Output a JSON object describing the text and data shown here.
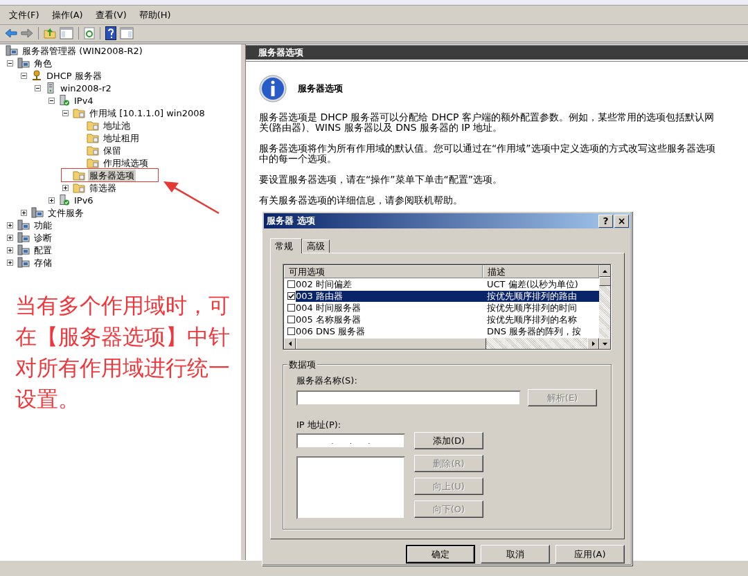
{
  "menu": [
    "文件(F)",
    "操作(A)",
    "查看(V)",
    "帮助(H)"
  ],
  "tree": {
    "label": "服务器管理器 (WIN2008-R2)",
    "kind": "computer",
    "selected": false,
    "children": [
      {
        "label": "角色",
        "kind": "computer",
        "expanded": true,
        "selected": false,
        "children": [
          {
            "label": "DHCP 服务器",
            "kind": "network",
            "expanded": true,
            "selected": false,
            "children": [
              {
                "label": "win2008-r2",
                "kind": "tower",
                "expanded": true,
                "selected": false,
                "children": [
                  {
                    "label": "IPv4",
                    "kind": "tower-check",
                    "expanded": true,
                    "selected": false,
                    "children": [
                      {
                        "label": "作用域 [10.1.1.0] win2008",
                        "kind": "folder",
                        "expanded": true,
                        "selected": false,
                        "children": [
                          {
                            "label": "地址池",
                            "kind": "folder",
                            "selected": false
                          },
                          {
                            "label": "地址租用",
                            "kind": "folder",
                            "selected": false
                          },
                          {
                            "label": "保留",
                            "kind": "folder",
                            "selected": false
                          },
                          {
                            "label": "作用域选项",
                            "kind": "folder",
                            "selected": false
                          }
                        ]
                      },
                      {
                        "label": "服务器选项",
                        "kind": "folder",
                        "selected": true
                      },
                      {
                        "label": "筛选器",
                        "kind": "folder",
                        "expanded": false,
                        "selected": false
                      }
                    ]
                  },
                  {
                    "label": "IPv6",
                    "kind": "tower-check",
                    "expanded": false,
                    "selected": false
                  }
                ]
              }
            ]
          },
          {
            "label": "文件服务",
            "kind": "computer",
            "expanded": false,
            "selected": false
          }
        ]
      },
      {
        "label": "功能",
        "kind": "computer",
        "expanded": false,
        "selected": false
      },
      {
        "label": "诊断",
        "kind": "computer",
        "expanded": false,
        "selected": false
      },
      {
        "label": "配置",
        "kind": "computer",
        "expanded": false,
        "selected": false
      },
      {
        "label": "存储",
        "kind": "computer",
        "expanded": false,
        "selected": false
      }
    ]
  },
  "annotation": "当有多个作用域时，可在【服务器选项】中针对所有作用域进行统一设置。",
  "details": {
    "header": "服务器选项",
    "title": "服务器选项",
    "paragraphs": [
      "服务器选项是 DHCP 服务器可以分配给 DHCP 客户端的额外配置参数。例如，某些常用的选项包括默认网关(路由器)、WINS 服务器以及 DNS 服务器的 IP 地址。",
      "服务器选项将作为所有作用域的默认值。您可以通过在“作用域”选项中定义选项的方式改写这些服务器选项中的每一个选项。",
      "要设置服务器选项，请在“操作”菜单下单击“配置”选项。",
      "有关服务器选项的详细信息，请参阅联机帮助。"
    ]
  },
  "dialog": {
    "title": "服务器 选项",
    "title_buttons": [
      "?",
      "×"
    ],
    "tabs": [
      {
        "label": "常规",
        "selected": true
      },
      {
        "label": "高级",
        "selected": false
      }
    ],
    "list": {
      "columns": [
        "可用选项",
        "描述"
      ],
      "rows": [
        {
          "checked": false,
          "selected": false,
          "option": "002 时间偏差",
          "description": "UCT 偏差(以秒为单位)"
        },
        {
          "checked": true,
          "selected": true,
          "option": "003 路由器",
          "description": "按优先顺序排列的路由"
        },
        {
          "checked": false,
          "selected": false,
          "option": "004 时间服务器",
          "description": "按优先顺序排列的时间"
        },
        {
          "checked": false,
          "selected": false,
          "option": "005 名称服务器",
          "description": "按优先顺序排列的名称"
        },
        {
          "checked": false,
          "selected": false,
          "option": "006 DNS 服务器",
          "description": "DNS 服务器的阵列，按"
        }
      ]
    },
    "group": {
      "title": "数据项",
      "server_name_label": "服务器名称(S):",
      "resolve_button": {
        "label": "解析(E)",
        "disabled": true
      },
      "ip_label": "IP 地址(P):",
      "ip_separators": [
        ".",
        ".",
        "."
      ],
      "side_buttons": [
        {
          "label": "添加(D)",
          "disabled": false
        },
        {
          "label": "删除(R)",
          "disabled": true
        },
        {
          "label": "向上(U)",
          "disabled": true
        },
        {
          "label": "向下(O)",
          "disabled": true
        }
      ]
    },
    "buttons": [
      {
        "label": "确定",
        "default": true
      },
      {
        "label": "取消",
        "default": false
      },
      {
        "label": "应用(A)",
        "default": false
      }
    ]
  }
}
